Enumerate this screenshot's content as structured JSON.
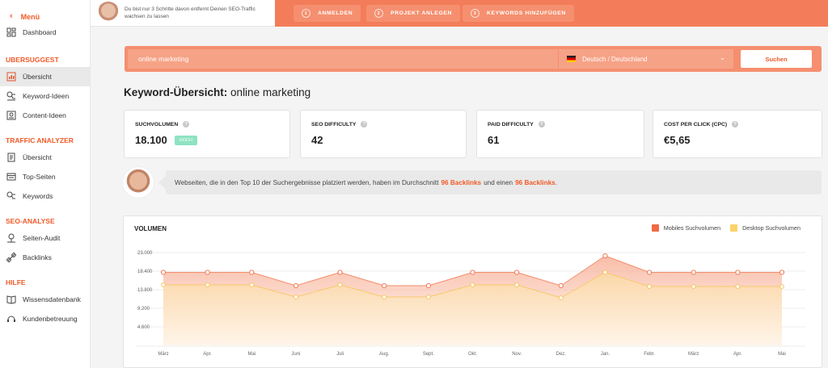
{
  "sidebar": {
    "menu_label": "Menü",
    "dashboard": "Dashboard",
    "sections": [
      {
        "title": "UBERSUGGEST",
        "items": [
          {
            "label": "Übersicht",
            "icon": "overview-icon",
            "active": true
          },
          {
            "label": "Keyword-Ideen",
            "icon": "keyword-ideas-icon"
          },
          {
            "label": "Content-Ideen",
            "icon": "content-ideas-icon"
          }
        ]
      },
      {
        "title": "TRAFFIC ANALYZER",
        "items": [
          {
            "label": "Übersicht",
            "icon": "traffic-overview-icon"
          },
          {
            "label": "Top-Seiten",
            "icon": "top-pages-icon"
          },
          {
            "label": "Keywords",
            "icon": "keywords-icon"
          }
        ]
      },
      {
        "title": "SEO-ANALYSE",
        "items": [
          {
            "label": "Seiten-Audit",
            "icon": "site-audit-icon"
          },
          {
            "label": "Backlinks",
            "icon": "backlinks-icon"
          }
        ]
      },
      {
        "title": "HILFE",
        "items": [
          {
            "label": "Wissensdatenbank",
            "icon": "knowledge-base-icon"
          },
          {
            "label": "Kundenbetreuung",
            "icon": "support-headset-icon"
          }
        ]
      }
    ]
  },
  "topbar": {
    "promo_text": "Du bist nur 3 Schritte davon entfernt Deinen SEO-Traffic wachsen zu lassen",
    "steps": [
      {
        "num": "1",
        "label": "ANMELDEN"
      },
      {
        "num": "2",
        "label": "PROJEKT ANLEGEN"
      },
      {
        "num": "3",
        "label": "KEYWORDS HINZUFÜGEN"
      }
    ]
  },
  "search": {
    "query": "online marketing",
    "language": "Deutsch / Deutschland",
    "button": "Suchen"
  },
  "heading": {
    "bold": "Keyword-Übersicht:",
    "term": "online marketing"
  },
  "stats": [
    {
      "label": "SUCHVOLUMEN",
      "value": "18.100",
      "badge": "HOCH"
    },
    {
      "label": "SEO DIFFICULTY",
      "value": "42"
    },
    {
      "label": "PAID DIFFICULTY",
      "value": "61"
    },
    {
      "label": "COST PER CLICK (CPC)",
      "value": "€5,65"
    }
  ],
  "tip": {
    "before": "Webseiten, die in den Top 10 der Suchergebnisse platziert werden, haben im Durchschnitt",
    "hl1": "96 Backlinks",
    "middle": "und einen",
    "hl2": "96 Backlinks",
    "after": "."
  },
  "colors": {
    "accent": "#f05a28",
    "mobile": "#f06a45",
    "desktop": "#fcd36a"
  },
  "chart_data": {
    "type": "area",
    "title": "VOLUMEN",
    "categories": [
      "März",
      "Apr.",
      "Mai",
      "Juni",
      "Juli",
      "Aug.",
      "Sept.",
      "Okt.",
      "Nov.",
      "Dez.",
      "Jan.",
      "Febr.",
      "März",
      "Apr.",
      "Mai"
    ],
    "y_ticks": [
      "23.000",
      "18.400",
      "13.800",
      "9.200",
      "4.600"
    ],
    "ylim": [
      0,
      23000
    ],
    "grid": true,
    "legend_position": "top-right",
    "series": [
      {
        "name": "Mobiles Suchvolumen",
        "values": [
          18100,
          18100,
          18100,
          14800,
          18100,
          14800,
          14800,
          18100,
          18100,
          14800,
          22200,
          18100,
          18100,
          18100,
          18100
        ]
      },
      {
        "name": "Desktop Suchvolumen",
        "values": [
          15000,
          15000,
          15000,
          12000,
          15000,
          12000,
          12000,
          15000,
          15000,
          11800,
          18100,
          14600,
          14600,
          14600,
          14600
        ]
      }
    ]
  }
}
